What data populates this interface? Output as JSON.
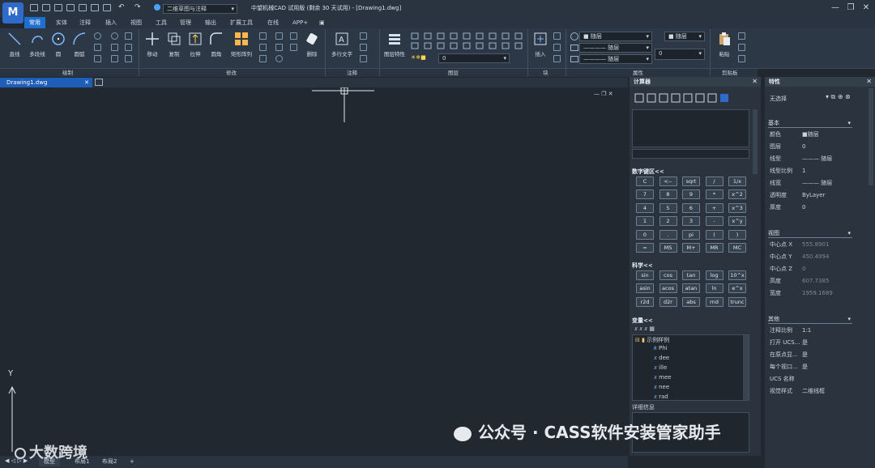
{
  "app": {
    "title": "中望机械CAD 试用版 (剩余 30 天试用) - [Drawing1.dwg]",
    "logo_text": "M",
    "workspace": "二维草图与注释"
  },
  "ribbon_tabs": [
    "常用",
    "实体",
    "注释",
    "插入",
    "视图",
    "工具",
    "管理",
    "输出",
    "扩展工具",
    "在线",
    "APP+"
  ],
  "groups": [
    "绘制",
    "修改",
    "注释",
    "图层",
    "块",
    "属性",
    "剪贴板"
  ],
  "draw_tools": [
    "直线",
    "多段线",
    "圆",
    "圆弧"
  ],
  "modify_tools": [
    "移动",
    "复制",
    "拉伸",
    "圆角",
    "矩形阵列",
    "删除"
  ],
  "annotation_tools": [
    "多行文字"
  ],
  "layer_tools": [
    "图层特性"
  ],
  "layer_combo_value": "0",
  "block_tools": [
    "插入"
  ],
  "props": {
    "color_combo": "随层",
    "layer_combo": "随层",
    "linetype_combo": "随层",
    "lineweight_combo": "随层",
    "value_combo": "0"
  },
  "clipboard_tools": [
    "粘贴"
  ],
  "doc_tab": "Drawing1.dwg",
  "calculator": {
    "title": "计算器",
    "numpad_title": "数字键区<<",
    "numpad": [
      [
        "C",
        "<--",
        "sqrt",
        "/",
        "1/x"
      ],
      [
        "7",
        "8",
        "9",
        "*",
        "x^2"
      ],
      [
        "4",
        "5",
        "6",
        "+",
        "x^3"
      ],
      [
        "1",
        "2",
        "3",
        "-",
        "x^y"
      ],
      [
        "0",
        ".",
        "pi",
        "(",
        ")"
      ],
      [
        "=",
        "MS",
        "M+",
        "MR",
        "MC"
      ]
    ],
    "sci_title": "科学<<",
    "sci": [
      [
        "sin",
        "cos",
        "tan",
        "log",
        "10^x"
      ],
      [
        "asin",
        "acos",
        "atan",
        "ln",
        "e^x"
      ],
      [
        "r2d",
        "d2r",
        "abs",
        "rnd",
        "trunc"
      ]
    ],
    "vars_title": "变量<<",
    "var_group": "示例样例",
    "vars": [
      "Phi",
      "dee",
      "ille",
      "mee",
      "nee",
      "rad"
    ],
    "details": "详细信息"
  },
  "properties": {
    "title": "特性",
    "selection": "无选择",
    "sections": {
      "basic": "基本",
      "view": "视图",
      "misc": "其他"
    },
    "basic_rows": [
      {
        "k": "颜色",
        "v": "■随层"
      },
      {
        "k": "图层",
        "v": "0"
      },
      {
        "k": "线型",
        "v": "——— 随层"
      },
      {
        "k": "线型比例",
        "v": "1"
      },
      {
        "k": "线宽",
        "v": "——— 随层"
      },
      {
        "k": "透明度",
        "v": "ByLayer"
      },
      {
        "k": "厚度",
        "v": "0"
      }
    ],
    "view_rows": [
      {
        "k": "中心点 X",
        "v": "555.8901"
      },
      {
        "k": "中心点 Y",
        "v": "450.4994"
      },
      {
        "k": "中心点 Z",
        "v": "0"
      },
      {
        "k": "高度",
        "v": "607.7385"
      },
      {
        "k": "宽度",
        "v": "1959.1689"
      }
    ],
    "misc_rows": [
      {
        "k": "注释比例",
        "v": "1:1"
      },
      {
        "k": "打开 UCS...",
        "v": "是"
      },
      {
        "k": "在原点显...",
        "v": "是"
      },
      {
        "k": "每个视口...",
        "v": "是"
      },
      {
        "k": "UCS 名称",
        "v": ""
      },
      {
        "k": "视觉样式",
        "v": "二维线框"
      }
    ]
  },
  "status_tabs": [
    "模型",
    "布局1",
    "布局2",
    "+"
  ],
  "axis_y": "Y",
  "watermark": "公众号 · CASS软件安装管家助手",
  "watermark2": "大数跨境"
}
